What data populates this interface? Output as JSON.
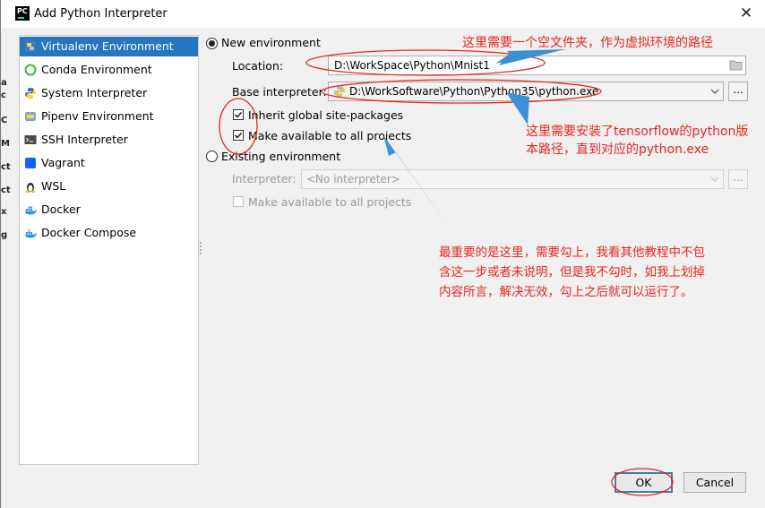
{
  "window": {
    "title": "Add Python Interpreter",
    "app_icon_text": "PC"
  },
  "left_strip": [
    "a",
    "c",
    "C",
    "M",
    "ct",
    "ct",
    "x",
    "g"
  ],
  "sidebar": {
    "items": [
      {
        "label": "Virtualenv Environment",
        "icon": "virtualenv-icon",
        "selected": true
      },
      {
        "label": "Conda Environment",
        "icon": "conda-icon"
      },
      {
        "label": "System Interpreter",
        "icon": "python-icon"
      },
      {
        "label": "Pipenv Environment",
        "icon": "pipenv-icon"
      },
      {
        "label": "SSH Interpreter",
        "icon": "terminal-icon"
      },
      {
        "label": "Vagrant",
        "icon": "vagrant-icon"
      },
      {
        "label": "WSL",
        "icon": "linux-icon"
      },
      {
        "label": "Docker",
        "icon": "docker-icon"
      },
      {
        "label": "Docker Compose",
        "icon": "docker-compose-icon"
      }
    ]
  },
  "new_env": {
    "label": "New environment",
    "location_label": "Location:",
    "location_value": "D:\\WorkSpace\\Python\\Mnist1",
    "base_label": "Base interpreter:",
    "base_value": "D:\\WorkSoftware\\Python\\Python35\\python.exe",
    "browse_label": "...",
    "inherit_label": "Inherit global site-packages",
    "make_available_label": "Make available to all projects"
  },
  "existing_env": {
    "label": "Existing environment",
    "interpreter_label": "Interpreter:",
    "interpreter_value": "<No interpreter>",
    "browse_label": "...",
    "make_available_label": "Make available to all projects"
  },
  "buttons": {
    "ok": "OK",
    "cancel": "Cancel"
  },
  "annotations": {
    "a1": "这里需要一个空文件夹，作为虚拟环境的路径",
    "a2_line1": "这里需要安装了tensorflow的python版",
    "a2_line2": "本路径，直到对应的python.exe",
    "a3_line1": "最重要的是这里，需要勾上，我看其他教程中不包",
    "a3_line2": "含这一步或者未说明，但是我不勾时，如我上划掉",
    "a3_line3": "内容所言，解决无效，勾上之后就可以运行了。",
    "color": "#e8261f",
    "arrow_color": "#3d8fd6"
  }
}
